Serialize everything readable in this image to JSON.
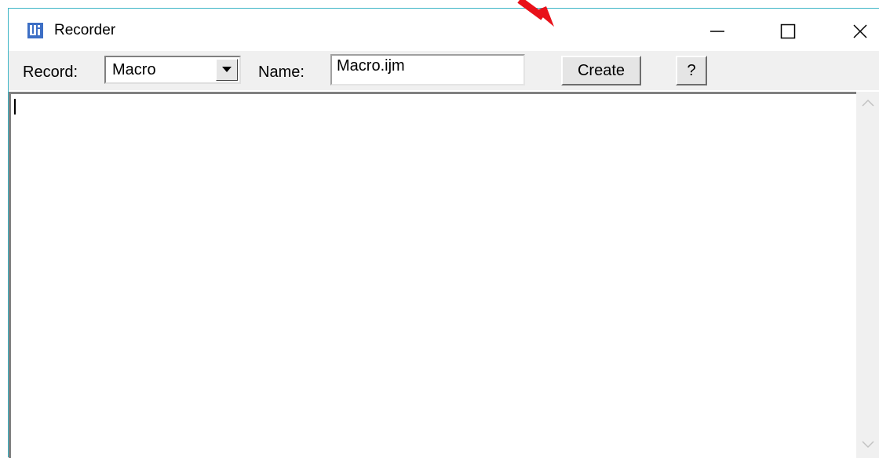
{
  "window": {
    "title": "Recorder",
    "icon": "imagej-icon",
    "controls": [
      "minimize-icon",
      "maximize-icon",
      "close-icon"
    ]
  },
  "toolbar": {
    "record_label": "Record:",
    "record_value": "Macro",
    "name_label": "Name:",
    "name_value": "Macro.ijm",
    "create_label": "Create",
    "help_label": "?"
  },
  "editor": {
    "content": ""
  },
  "annotation": {
    "type": "arrow",
    "color": "#e8111a"
  },
  "colors": {
    "border_accent": "#3db5c6",
    "icon_blue": "#3d6fc5"
  }
}
